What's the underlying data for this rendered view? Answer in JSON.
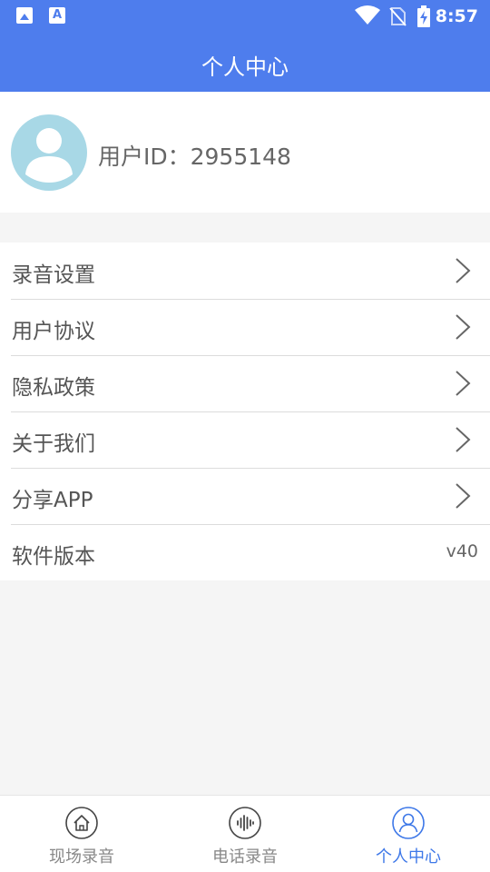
{
  "status_bar": {
    "time": "8:57",
    "icons": [
      "image-icon",
      "a-text-icon",
      "wifi-icon",
      "no-sim-icon",
      "battery-charging-icon"
    ]
  },
  "header": {
    "title": "个人中心"
  },
  "profile": {
    "user_id_text": "用户ID：2955148"
  },
  "menu": {
    "items": [
      {
        "label": "录音设置",
        "icon": "chevron-right-icon"
      },
      {
        "label": "用户协议",
        "icon": "chevron-right-icon"
      },
      {
        "label": "隐私政策",
        "icon": "chevron-right-icon"
      },
      {
        "label": "关于我们",
        "icon": "chevron-right-icon"
      },
      {
        "label": "分享APP",
        "icon": "chevron-right-icon"
      },
      {
        "label": "软件版本",
        "value": "v40"
      }
    ]
  },
  "bottom_nav": {
    "tabs": [
      {
        "label": "现场录音",
        "icon": "home-icon",
        "active": false
      },
      {
        "label": "电话录音",
        "icon": "sound-wave-icon",
        "active": false
      },
      {
        "label": "个人中心",
        "icon": "user-icon",
        "active": true
      }
    ]
  },
  "colors": {
    "primary": "#4e7ded",
    "active_tab": "#3e78e8",
    "avatar_bg": "#a8d8e6",
    "background": "#f5f5f5"
  }
}
